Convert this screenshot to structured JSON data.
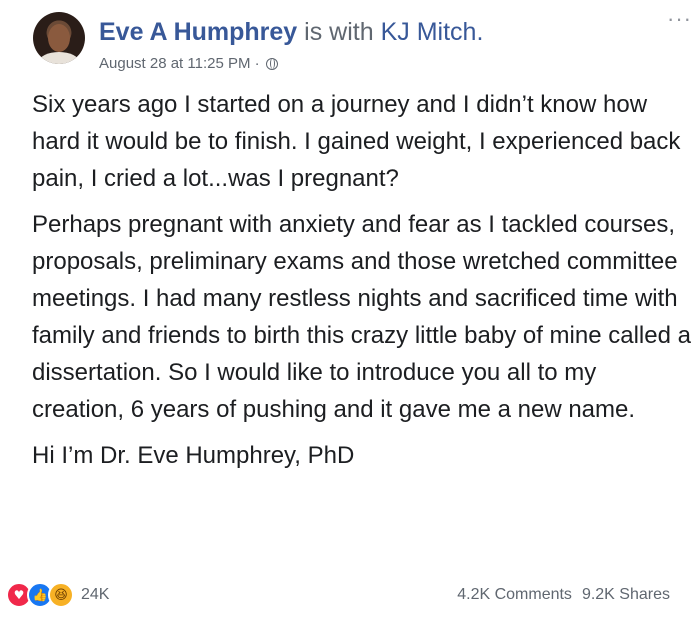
{
  "post": {
    "author": "Eve A Humphrey",
    "with_text": "is with",
    "tagged": "KJ Mitch.",
    "date": "August 28 at 11:25 PM ·",
    "more_label": "···",
    "paragraphs": [
      "Six years ago I started on a journey and I didn’t know how hard it would be to finish. I gained weight, I experienced back pain, I cried a lot...was I pregnant?",
      "Perhaps pregnant with anxiety and fear as I tackled courses, proposals, preliminary exams and those wretched committee meetings. I had many restless nights and sacrificed time with family and friends to birth this crazy little baby of mine called a dissertation. So I would like to introduce you all to my creation, 6 years of pushing and it gave me a new name.",
      "Hi I’m Dr. Eve Humphrey, PhD"
    ]
  },
  "footer": {
    "reactions": [
      {
        "icon": "love-reaction-icon",
        "glyph": "♥",
        "color": "#f0284a"
      },
      {
        "icon": "like-reaction-icon",
        "glyph": "👍",
        "color": "#1877f2"
      },
      {
        "icon": "haha-reaction-icon",
        "glyph": "😆",
        "color": "#f7b125"
      }
    ],
    "reaction_count": "24K",
    "comments": "4.2K Comments",
    "shares": "9.2K Shares"
  },
  "colors": {
    "link": "#385898",
    "secondary": "#606770",
    "text": "#1c1e21"
  }
}
